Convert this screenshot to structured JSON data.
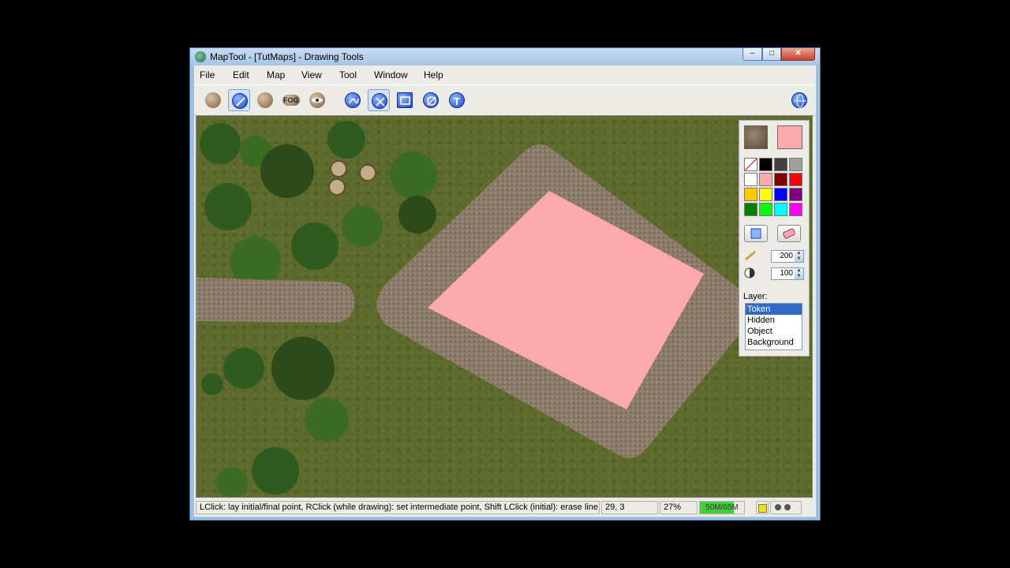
{
  "window": {
    "title": "MapTool - [TutMaps] - Drawing Tools",
    "min": "–",
    "max": "□",
    "close": "✕"
  },
  "menu": [
    "File",
    "Edit",
    "Map",
    "View",
    "Tool",
    "Window",
    "Help"
  ],
  "toolbar": {
    "fog_label": "FOG",
    "selected_tool": "line-tool"
  },
  "palette": {
    "fg_texture": "dirt-texture",
    "bg_color": "#ffaaaa",
    "colors": [
      "none",
      "#000000",
      "#404040",
      "#a0a0a0",
      "#ffffff",
      "#ffaaaa",
      "#800000",
      "#ff0000",
      "#ffc800",
      "#ffff00",
      "#0000ff",
      "#800080",
      "#008000",
      "#00ff00",
      "#00ffff",
      "#ff00ff"
    ],
    "pen_width": "200",
    "opacity": "100",
    "layer_label": "Layer:",
    "layers": [
      "Token",
      "Hidden",
      "Object",
      "Background"
    ],
    "selected_layer": "Token"
  },
  "status": {
    "hint": "LClick: lay initial/final point, RClick (while drawing): set intermediate point, Shift LClick (initial): erase line",
    "coords": "29, 3",
    "zoom": "27%",
    "memory": "50M/65M",
    "memory_fraction": 0.77
  },
  "colors": {
    "pink_fill": "#ffaaaa",
    "grass": "#5c6a2e",
    "road": "#8a7a68"
  }
}
